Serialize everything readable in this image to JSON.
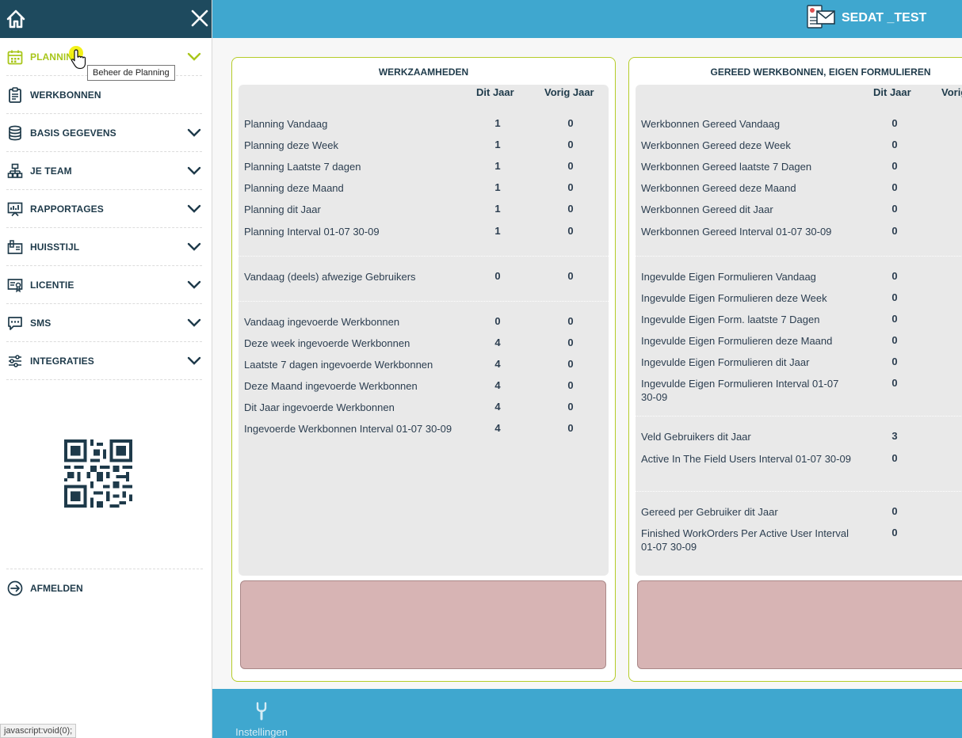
{
  "sidebar": {
    "items": [
      {
        "label": "PLANNING",
        "active": true
      },
      {
        "label": "WERKBONNEN"
      },
      {
        "label": "BASIS GEGEVENS"
      },
      {
        "label": "JE TEAM"
      },
      {
        "label": "RAPPORTAGES"
      },
      {
        "label": "HUISSTIJL"
      },
      {
        "label": "LICENTIE"
      },
      {
        "label": "SMS"
      },
      {
        "label": "INTEGRATIES"
      }
    ],
    "logout_label": "AFMELDEN",
    "tooltip": "Beheer de Planning",
    "accent_color": "#a8c61a",
    "dark_color": "#1e4a5e"
  },
  "header": {
    "username": "SEDAT _TEST",
    "color": "#3fa7cf"
  },
  "werkzaamheden": {
    "title": "WERKZAAMHEDEN",
    "col1": "Dit Jaar",
    "col2": "Vorig Jaar",
    "rows": [
      {
        "label": "Planning Vandaag",
        "v1": "1",
        "v2": "0"
      },
      {
        "label": "Planning deze Week",
        "v1": "1",
        "v2": "0"
      },
      {
        "label": "Planning Laatste 7 dagen",
        "v1": "1",
        "v2": "0"
      },
      {
        "label": "Planning deze Maand",
        "v1": "1",
        "v2": "0"
      },
      {
        "label": "Planning dit Jaar",
        "v1": "1",
        "v2": "0"
      },
      {
        "label": "Planning Interval 01-07 30-09",
        "v1": "1",
        "v2": "0"
      },
      {
        "label": "Vandaag (deels) afwezige Gebruikers",
        "v1": "0",
        "v2": "0"
      },
      {
        "label": "Vandaag ingevoerde Werkbonnen",
        "v1": "0",
        "v2": "0"
      },
      {
        "label": "Deze week ingevoerde Werkbonnen",
        "v1": "4",
        "v2": "0"
      },
      {
        "label": "Laatste 7 dagen ingevoerde Werkbonnen",
        "v1": "4",
        "v2": "0"
      },
      {
        "label": "Deze Maand ingevoerde Werkbonnen",
        "v1": "4",
        "v2": "0"
      },
      {
        "label": "Dit Jaar ingevoerde Werkbonnen",
        "v1": "4",
        "v2": "0"
      },
      {
        "label": "Ingevoerde Werkbonnen Interval 01-07 30-09",
        "v1": "4",
        "v2": "0"
      }
    ]
  },
  "gereed": {
    "title": "GEREED WERKBONNEN, EIGEN FORMULIEREN",
    "col1": "Dit Jaar",
    "col2": "Vorig Jaar",
    "rows": [
      {
        "label": "Werkbonnen Gereed Vandaag",
        "v1": "0"
      },
      {
        "label": "Werkbonnen Gereed deze Week",
        "v1": "0"
      },
      {
        "label": "Werkbonnen Gereed laatste 7 Dagen",
        "v1": "0"
      },
      {
        "label": "Werkbonnen Gereed deze Maand",
        "v1": "0"
      },
      {
        "label": "Werkbonnen Gereed dit Jaar",
        "v1": "0"
      },
      {
        "label": "Werkbonnen Gereed Interval 01-07 30-09",
        "v1": "0"
      },
      {
        "label": "Ingevulde Eigen Formulieren Vandaag",
        "v1": "0"
      },
      {
        "label": "Ingevulde Eigen Formulieren deze Week",
        "v1": "0"
      },
      {
        "label": "Ingevulde Eigen Form. laatste 7 Dagen",
        "v1": "0"
      },
      {
        "label": "Ingevulde Eigen Formulieren deze Maand",
        "v1": "0"
      },
      {
        "label": "Ingevulde Eigen Formulieren dit Jaar",
        "v1": "0"
      },
      {
        "label": "Ingevulde Eigen Formulieren Interval 01-07 30-09",
        "v1": "0"
      },
      {
        "label": "Veld Gebruikers dit Jaar",
        "v1": "3"
      },
      {
        "label": "Active In The Field Users Interval 01-07 30-09",
        "v1": "0"
      },
      {
        "label": "Gereed per Gebruiker dit Jaar",
        "v1": "0"
      },
      {
        "label": "Finished WorkOrders Per Active User Interval 01-07 30-09",
        "v1": "0"
      }
    ]
  },
  "footer": {
    "settings_label": "Instellingen"
  },
  "statusbar": "javascript:void(0);"
}
